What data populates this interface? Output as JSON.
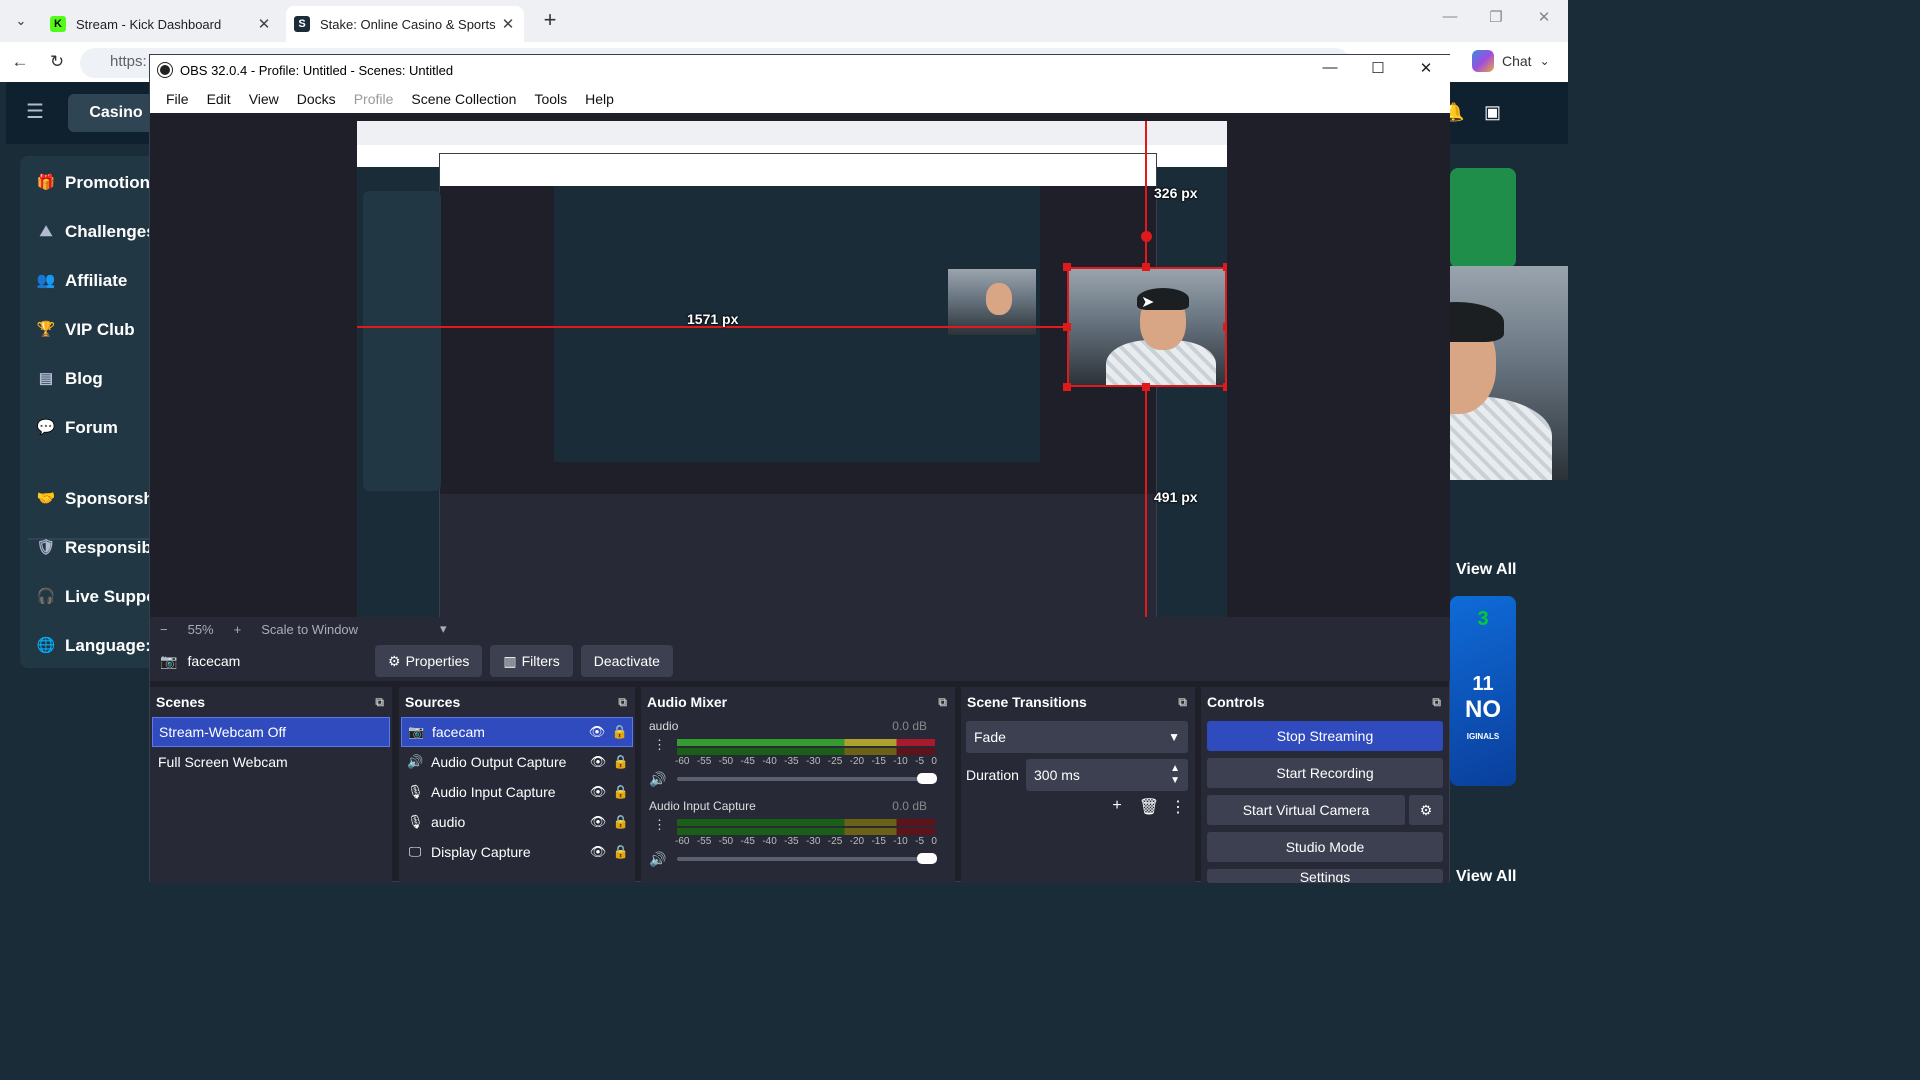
{
  "browser": {
    "tabs": [
      {
        "title": "Stream - Kick Dashboard",
        "favicon": "K",
        "favicon_color": "#53fc18"
      },
      {
        "title": "Stake: Online Casino & Sports Bett",
        "favicon": "S",
        "favicon_color": "#1a2c38"
      }
    ],
    "url": "https:",
    "chat_label": "Chat"
  },
  "site": {
    "casino_label": "Casino",
    "sidebar": [
      {
        "label": "Promotions",
        "icon": "gift-icon"
      },
      {
        "label": "Challenges",
        "icon": "trophy-climb-icon"
      },
      {
        "label": "Affiliate",
        "icon": "users-icon"
      },
      {
        "label": "VIP Club",
        "icon": "trophy-icon"
      },
      {
        "label": "Blog",
        "icon": "blog-icon"
      },
      {
        "label": "Forum",
        "icon": "forum-icon"
      },
      {
        "label": "Sponsorshi",
        "icon": "sponsorship-icon"
      },
      {
        "label": "Responsibl",
        "icon": "shield-check-icon"
      },
      {
        "label": "Live Suppor",
        "icon": "headset-icon"
      },
      {
        "label": "Language:",
        "icon": "globe-icon"
      }
    ],
    "view_all": "View All",
    "view_all_2": "View All",
    "game_card_text": "NO",
    "game_card_small": "IGINALS",
    "game_card_num1": "3",
    "game_card_num2": "11"
  },
  "obs": {
    "title": "OBS 32.0.4 - Profile: Untitled - Scenes: Untitled",
    "menu": [
      "File",
      "Edit",
      "View",
      "Docks",
      "Profile",
      "Scene Collection",
      "Tools",
      "Help"
    ],
    "zoom": {
      "minus": "−",
      "value": "55%",
      "plus": "+",
      "scale": "Scale to Window"
    },
    "source_toolbar": {
      "selected_source": "facecam",
      "properties": "Properties",
      "filters": "Filters",
      "deactivate": "Deactivate"
    },
    "overlay": {
      "label_px_1": "1571 px",
      "label_px_2": "326 px",
      "label_px_3": "491 px"
    },
    "scenes": {
      "header": "Scenes",
      "items": [
        "Stream-Webcam Off",
        "Full Screen Webcam"
      ]
    },
    "sources": {
      "header": "Sources",
      "items": [
        {
          "label": "facecam",
          "icon": "camera-icon"
        },
        {
          "label": "Audio Output Capture",
          "icon": "speaker-icon"
        },
        {
          "label": "Audio Input Capture",
          "icon": "microphone-icon"
        },
        {
          "label": "audio",
          "icon": "microphone-icon"
        },
        {
          "label": "Display Capture",
          "icon": "monitor-icon"
        }
      ]
    },
    "mixer": {
      "header": "Audio Mixer",
      "scale": [
        "-60",
        "-55",
        "-50",
        "-45",
        "-40",
        "-35",
        "-30",
        "-25",
        "-20",
        "-15",
        "-10",
        "-5",
        "0"
      ],
      "channels": [
        {
          "name": "audio",
          "db": "0.0 dB"
        },
        {
          "name": "Audio Input Capture",
          "db": "0.0 dB"
        }
      ]
    },
    "transitions": {
      "header": "Scene Transitions",
      "selected": "Fade",
      "duration_label": "Duration",
      "duration_value": "300 ms"
    },
    "controls": {
      "header": "Controls",
      "stop_streaming": "Stop Streaming",
      "start_recording": "Start Recording",
      "start_virtual_camera": "Start Virtual Camera",
      "studio_mode": "Studio Mode",
      "settings": "Settings"
    }
  }
}
